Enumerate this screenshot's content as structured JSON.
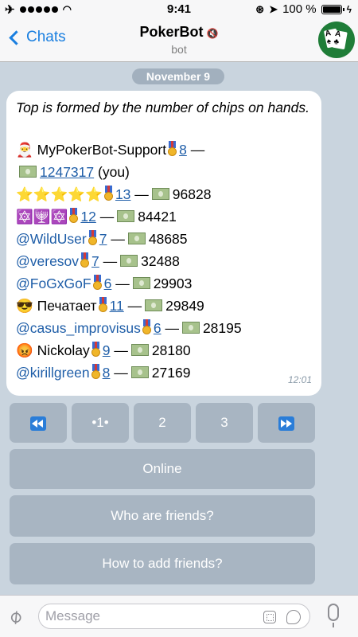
{
  "status_bar": {
    "carrier_icon": "airplane-icon",
    "time": "9:41",
    "battery": "100 %"
  },
  "header": {
    "back_label": "Chats",
    "title": "PokerBot",
    "subtitle": "bot"
  },
  "date_separator": "November 9",
  "message": {
    "intro": "Top is formed by the number of chips on hands.",
    "rows": [
      {
        "prefix": "🎅 MyPokerBot-Support",
        "prefix_type": "text",
        "rank": "8",
        "chips_prefix": "",
        "chips": "1247317",
        "suffix": "(you)"
      },
      {
        "prefix": "⭐⭐⭐⭐⭐",
        "prefix_type": "text",
        "rank": "13",
        "chips": "96828"
      },
      {
        "prefix": "🔯🕎🔯",
        "prefix_type": "text",
        "rank": "12",
        "chips": "84421"
      },
      {
        "prefix": "@WildUser",
        "prefix_type": "mention",
        "rank": "7",
        "chips": "48685"
      },
      {
        "prefix": "@veresov",
        "prefix_type": "mention",
        "rank": "7",
        "chips": "32488"
      },
      {
        "prefix": "@FoGxGoF",
        "prefix_type": "mention",
        "rank": "6",
        "chips": "29903"
      },
      {
        "prefix": "😎 Печатает",
        "prefix_type": "text",
        "rank": "11",
        "chips": "29849"
      },
      {
        "prefix": "@casus_improvisus",
        "prefix_type": "mention",
        "rank": "6",
        "chips": "28195"
      },
      {
        "prefix": "😡 Nickolay",
        "prefix_type": "text",
        "rank": "9",
        "chips": "28180"
      },
      {
        "prefix": "@kirillgreen",
        "prefix_type": "mention",
        "rank": "8",
        "chips": "27169"
      }
    ],
    "dash": "—",
    "time": "12:01"
  },
  "keyboard": {
    "page_buttons": [
      {
        "label": "",
        "icon": "rewind-icon"
      },
      {
        "label": "•1•"
      },
      {
        "label": "2"
      },
      {
        "label": "3"
      },
      {
        "label": "",
        "icon": "fast-forward-icon"
      }
    ],
    "online": "Online",
    "who_friends": "Who are friends?",
    "add_friends": "How to add friends?"
  },
  "input": {
    "placeholder": "Message"
  },
  "colors": {
    "link": "#1f5ea8",
    "accent": "#1a7fe0",
    "button_bg": "#94a2b2"
  }
}
